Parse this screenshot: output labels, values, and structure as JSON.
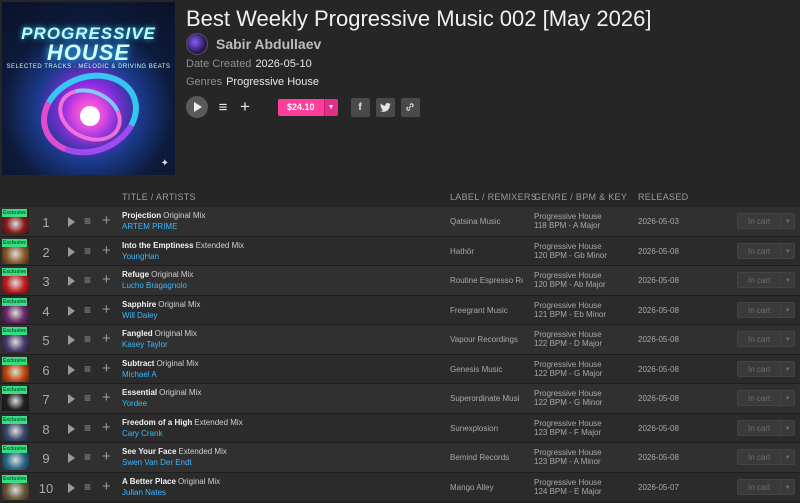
{
  "release": {
    "cover": {
      "line1": "PROGRESSIVE",
      "line2": "HOUSE",
      "line3": "SELECTED TRACKS · MELODIC & DRIVING BEATS",
      "icon": "sparkle-icon"
    },
    "title": "Best Weekly Progressive Music 002 [May 2026]",
    "artist": "Sabir Abdullaev",
    "date_created_label": "Date Created",
    "date_created": "2026-05-10",
    "genres_label": "Genres",
    "genres": "Progressive House",
    "price": "$24.10"
  },
  "icons": {
    "play": "play-icon",
    "queue": "add-to-queue-icon",
    "add": "plus-icon",
    "facebook": "facebook-icon",
    "twitter": "twitter-icon",
    "link": "link-icon",
    "dropdown": "chevron-down-icon"
  },
  "colors": {
    "accent": "#ff3d9b",
    "artist_link": "#3ab7ff",
    "exclusive_badge": "#3ddc84"
  },
  "table": {
    "headers": {
      "title": "TITLE / ARTISTS",
      "label": "LABEL / REMIXERS",
      "genre": "GENRE / BPM & KEY",
      "released": "RELEASED"
    },
    "exclusive_label": "Exclusive",
    "cart_label": "In cart",
    "rows": [
      {
        "num": "1",
        "title": "Projection",
        "mix": "Original Mix",
        "artist": "ARTEM PRIME",
        "label": "Qatsina Music",
        "genre": "Progressive House",
        "bpm_key": "118 BPM - A Major",
        "released": "2026-05-03",
        "art": "#8a1a1a"
      },
      {
        "num": "2",
        "title": "Into the Emptiness",
        "mix": "Extended Mix",
        "artist": "YoungHan",
        "label": "Hathör",
        "genre": "Progressive House",
        "bpm_key": "120 BPM - Gb Minor",
        "released": "2026-05-08",
        "art": "#8a5a2a"
      },
      {
        "num": "3",
        "title": "Refuge",
        "mix": "Original Mix",
        "artist": "Lucho Bragagnolo",
        "label": "Routine Espresso Re",
        "genre": "Progressive House",
        "bpm_key": "120 BPM - Ab Major",
        "released": "2026-05-08",
        "art": "#c02020"
      },
      {
        "num": "4",
        "title": "Sapphire",
        "mix": "Original Mix",
        "artist": "Will Daley",
        "label": "Freegrant Music",
        "genre": "Progressive House",
        "bpm_key": "121 BPM - Eb Minor",
        "released": "2026-05-08",
        "art": "#6a2a6a"
      },
      {
        "num": "5",
        "title": "Fangled",
        "mix": "Original Mix",
        "artist": "Kasey Taylor",
        "label": "Vapour Recordings",
        "genre": "Progressive House",
        "bpm_key": "122 BPM - D Major",
        "released": "2026-05-08",
        "art": "#4a3a6a"
      },
      {
        "num": "6",
        "title": "Subtract",
        "mix": "Original Mix",
        "artist": "Michael A",
        "label": "Genesis Music",
        "genre": "Progressive House",
        "bpm_key": "122 BPM - G Major",
        "released": "2026-05-08",
        "art": "#c04a10"
      },
      {
        "num": "7",
        "title": "Essential",
        "mix": "Original Mix",
        "artist": "Yordee",
        "label": "Superordinate Musi",
        "genre": "Progressive House",
        "bpm_key": "122 BPM - G Minor",
        "released": "2026-05-08",
        "art": "#202020"
      },
      {
        "num": "8",
        "title": "Freedom of a High",
        "mix": "Extended Mix",
        "artist": "Cary Crank",
        "label": "Sunexplosion",
        "genre": "Progressive House",
        "bpm_key": "123 BPM - F Major",
        "released": "2026-05-08",
        "art": "#3a4a6a"
      },
      {
        "num": "9",
        "title": "See Your Face",
        "mix": "Extended Mix",
        "artist": "Swen Van Der Endt",
        "label": "Bemind Records",
        "genre": "Progressive House",
        "bpm_key": "123 BPM - A Minor",
        "released": "2026-05-08",
        "art": "#2a6a8a"
      },
      {
        "num": "10",
        "title": "A Better Place",
        "mix": "Original Mix",
        "artist": "Julian Nates",
        "label": "Mango Alley",
        "genre": "Progressive House",
        "bpm_key": "124 BPM - E Major",
        "released": "2026-05-07",
        "art": "#6a5a3a"
      }
    ]
  }
}
